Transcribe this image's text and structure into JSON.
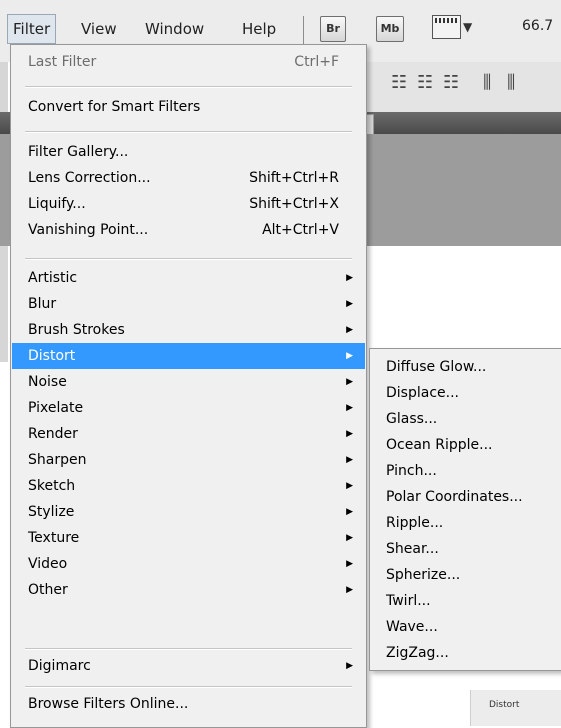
{
  "menubar": {
    "items": [
      "Filter",
      "View",
      "Window",
      "Help"
    ],
    "badges": [
      "Br",
      "Mb"
    ],
    "zoom": "66.7"
  },
  "filter_menu": {
    "groups": [
      [
        {
          "label": "Last Filter",
          "shortcut": "Ctrl+F",
          "disabled": true
        }
      ],
      [
        {
          "label": "Convert for Smart Filters"
        }
      ],
      [
        {
          "label": "Filter Gallery..."
        },
        {
          "label": "Lens Correction...",
          "shortcut": "Shift+Ctrl+R"
        },
        {
          "label": "Liquify...",
          "shortcut": "Shift+Ctrl+X"
        },
        {
          "label": "Vanishing Point...",
          "shortcut": "Alt+Ctrl+V"
        }
      ],
      [
        {
          "label": "Artistic",
          "submenu": true
        },
        {
          "label": "Blur",
          "submenu": true
        },
        {
          "label": "Brush Strokes",
          "submenu": true
        },
        {
          "label": "Distort",
          "submenu": true,
          "highlighted": true
        },
        {
          "label": "Noise",
          "submenu": true
        },
        {
          "label": "Pixelate",
          "submenu": true
        },
        {
          "label": "Render",
          "submenu": true
        },
        {
          "label": "Sharpen",
          "submenu": true
        },
        {
          "label": "Sketch",
          "submenu": true
        },
        {
          "label": "Stylize",
          "submenu": true
        },
        {
          "label": "Texture",
          "submenu": true
        },
        {
          "label": "Video",
          "submenu": true
        },
        {
          "label": "Other",
          "submenu": true
        }
      ],
      [
        {
          "label": "Digimarc",
          "submenu": true
        }
      ],
      [
        {
          "label": "Browse Filters Online..."
        }
      ]
    ]
  },
  "distort_submenu": {
    "items": [
      "Diffuse Glow...",
      "Displace...",
      "Glass...",
      "Ocean Ripple...",
      "Pinch...",
      "Polar Coordinates...",
      "Ripple...",
      "Shear...",
      "Spherize...",
      "Twirl...",
      "Wave...",
      "ZigZag..."
    ]
  },
  "background": {
    "panel_text": "Distort"
  }
}
